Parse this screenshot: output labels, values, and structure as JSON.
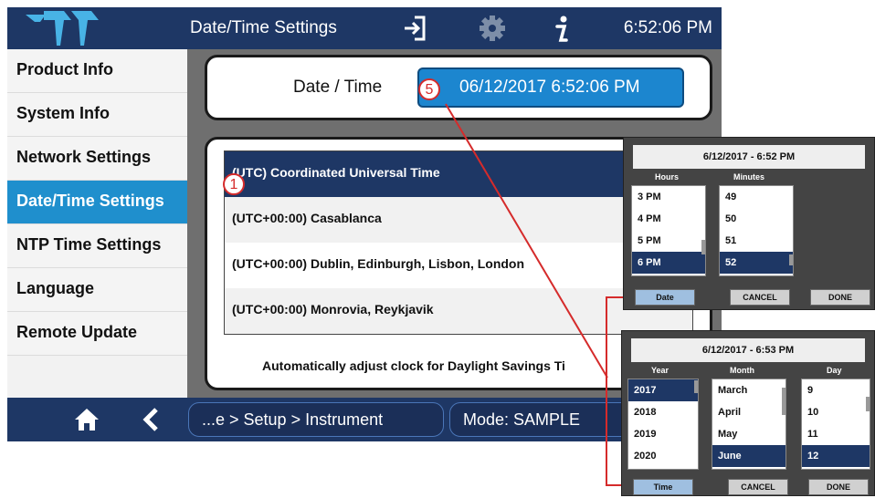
{
  "header": {
    "title": "Date/Time Settings",
    "clock": "6:52:06 PM",
    "icons": [
      "teledyne-logo",
      "exit-icon",
      "gear-icon",
      "info-icon"
    ]
  },
  "sidebar": {
    "items": [
      {
        "label": "Product Info"
      },
      {
        "label": "System Info"
      },
      {
        "label": "Network Settings"
      },
      {
        "label": "Date/Time Settings",
        "active": true
      },
      {
        "label": "NTP Time Settings"
      },
      {
        "label": "Language"
      },
      {
        "label": "Remote Update"
      }
    ]
  },
  "datetime": {
    "label": "Date / Time",
    "value": "06/12/2017 6:52:06 PM",
    "marker": "5"
  },
  "timezones": {
    "items": [
      "(UTC) Coordinated Universal Time",
      "(UTC+00:00) Casablanca",
      "(UTC+00:00) Dublin, Edinburgh, Lisbon, London",
      "(UTC+00:00) Monrovia, Reykjavik"
    ],
    "selected_index": 0,
    "marker": "1",
    "dst_text": "Automatically adjust clock for Daylight Savings Ti"
  },
  "footer": {
    "breadcrumb": "...e > Setup > Instrument",
    "mode": "Mode: SAMPLE"
  },
  "popup_time": {
    "title": "6/12/2017 - 6:52 PM",
    "hours_header": "Hours",
    "minutes_header": "Minutes",
    "hours": [
      "3 PM",
      "4 PM",
      "5 PM",
      "6 PM"
    ],
    "minutes": [
      "49",
      "50",
      "51",
      "52"
    ],
    "btn_date": "Date",
    "btn_cancel": "CANCEL",
    "btn_done": "DONE"
  },
  "popup_date": {
    "title": "6/12/2017 - 6:53 PM",
    "year_header": "Year",
    "month_header": "Month",
    "day_header": "Day",
    "years": [
      "2017",
      "2018",
      "2019",
      "2020"
    ],
    "months": [
      "March",
      "April",
      "May",
      "June"
    ],
    "days": [
      "9",
      "10",
      "11",
      "12"
    ],
    "btn_time": "Time",
    "btn_cancel": "CANCEL",
    "btn_done": "DONE"
  },
  "colors": {
    "navy": "#1e3765",
    "accent_blue": "#1f8fcd",
    "marker_red": "#d52b2b"
  }
}
